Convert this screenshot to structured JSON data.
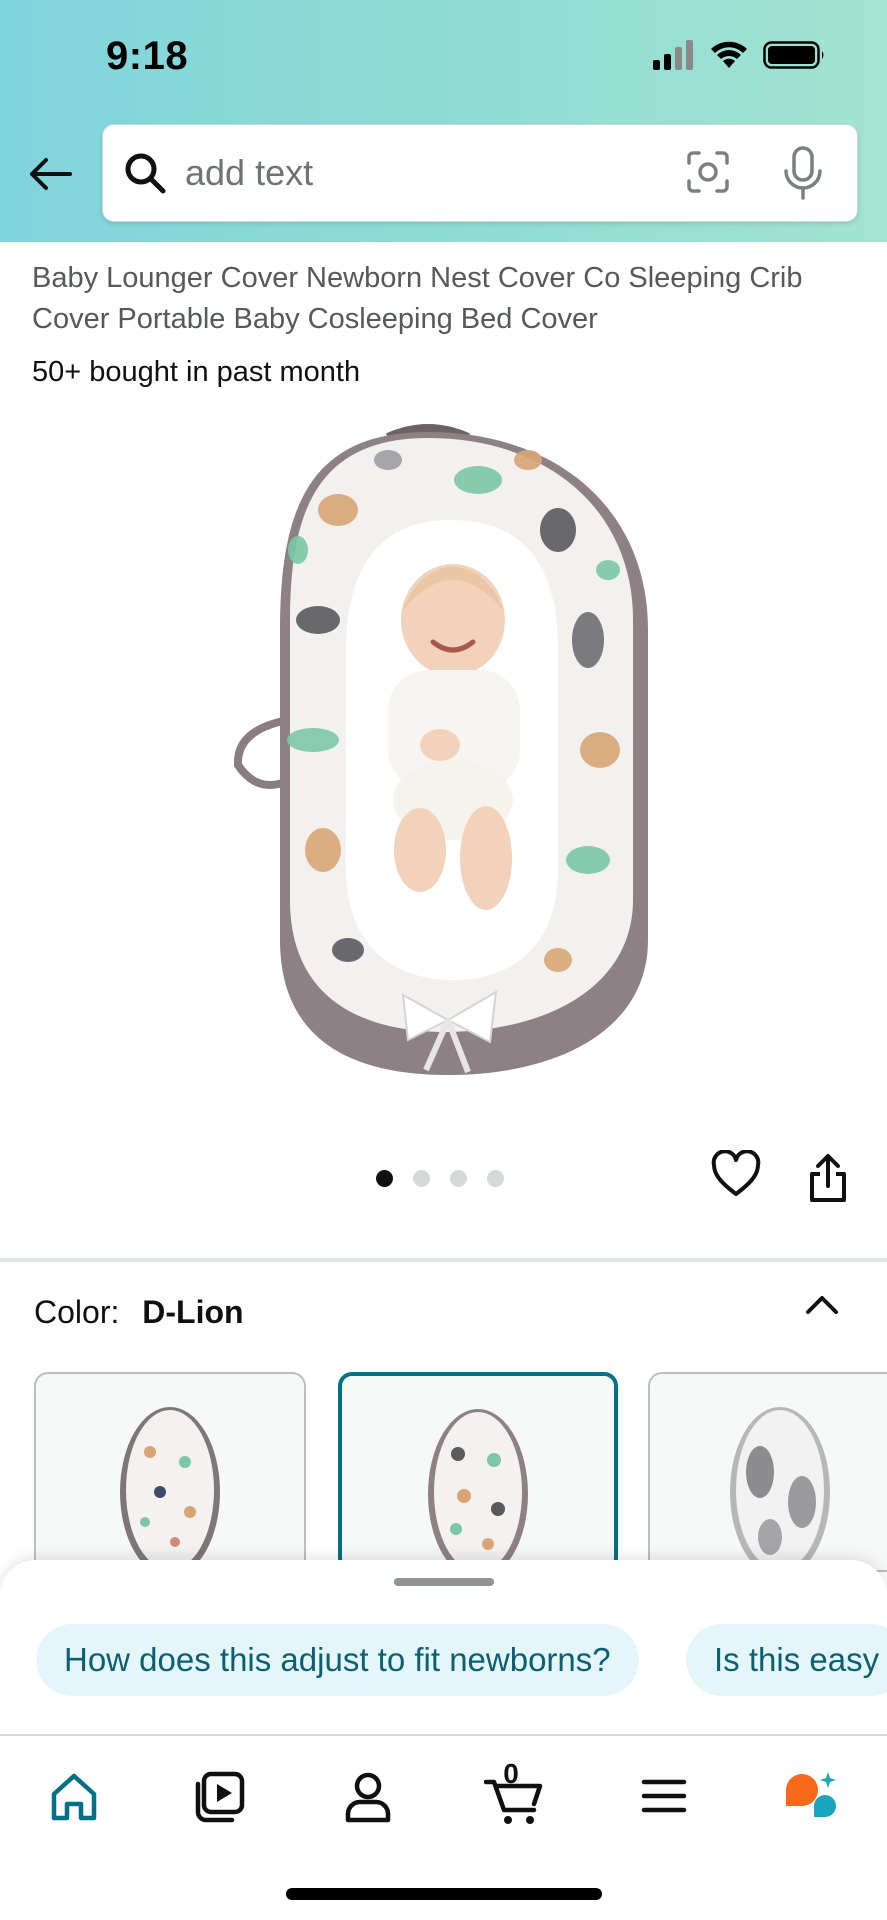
{
  "status_bar": {
    "time": "9:18"
  },
  "search": {
    "placeholder": "add text"
  },
  "product": {
    "title": "Baby Lounger Cover Newborn Nest Cover Co Sleeping Crib Cover Portable Baby Cosleeping Bed Cover",
    "bought_info": "50+ bought in past month",
    "image_pages": 4,
    "current_image": 1
  },
  "color": {
    "label": "Color:",
    "value": "D-Lion"
  },
  "suggestions": [
    "How does this adjust to fit newborns?",
    "Is this easy"
  ],
  "nav": {
    "cart_count": "0",
    "items": [
      "home-icon",
      "video-icon",
      "account-icon",
      "cart-icon",
      "menu-icon",
      "rufus-assistant-icon"
    ]
  },
  "colors": {
    "header_gradient": [
      "#80d4dc",
      "#a4e3d0"
    ],
    "accent": "#007185",
    "home_active": "#007185",
    "rufus_orange": "#f76a1b",
    "rufus_teal": "#1ba5bd"
  }
}
